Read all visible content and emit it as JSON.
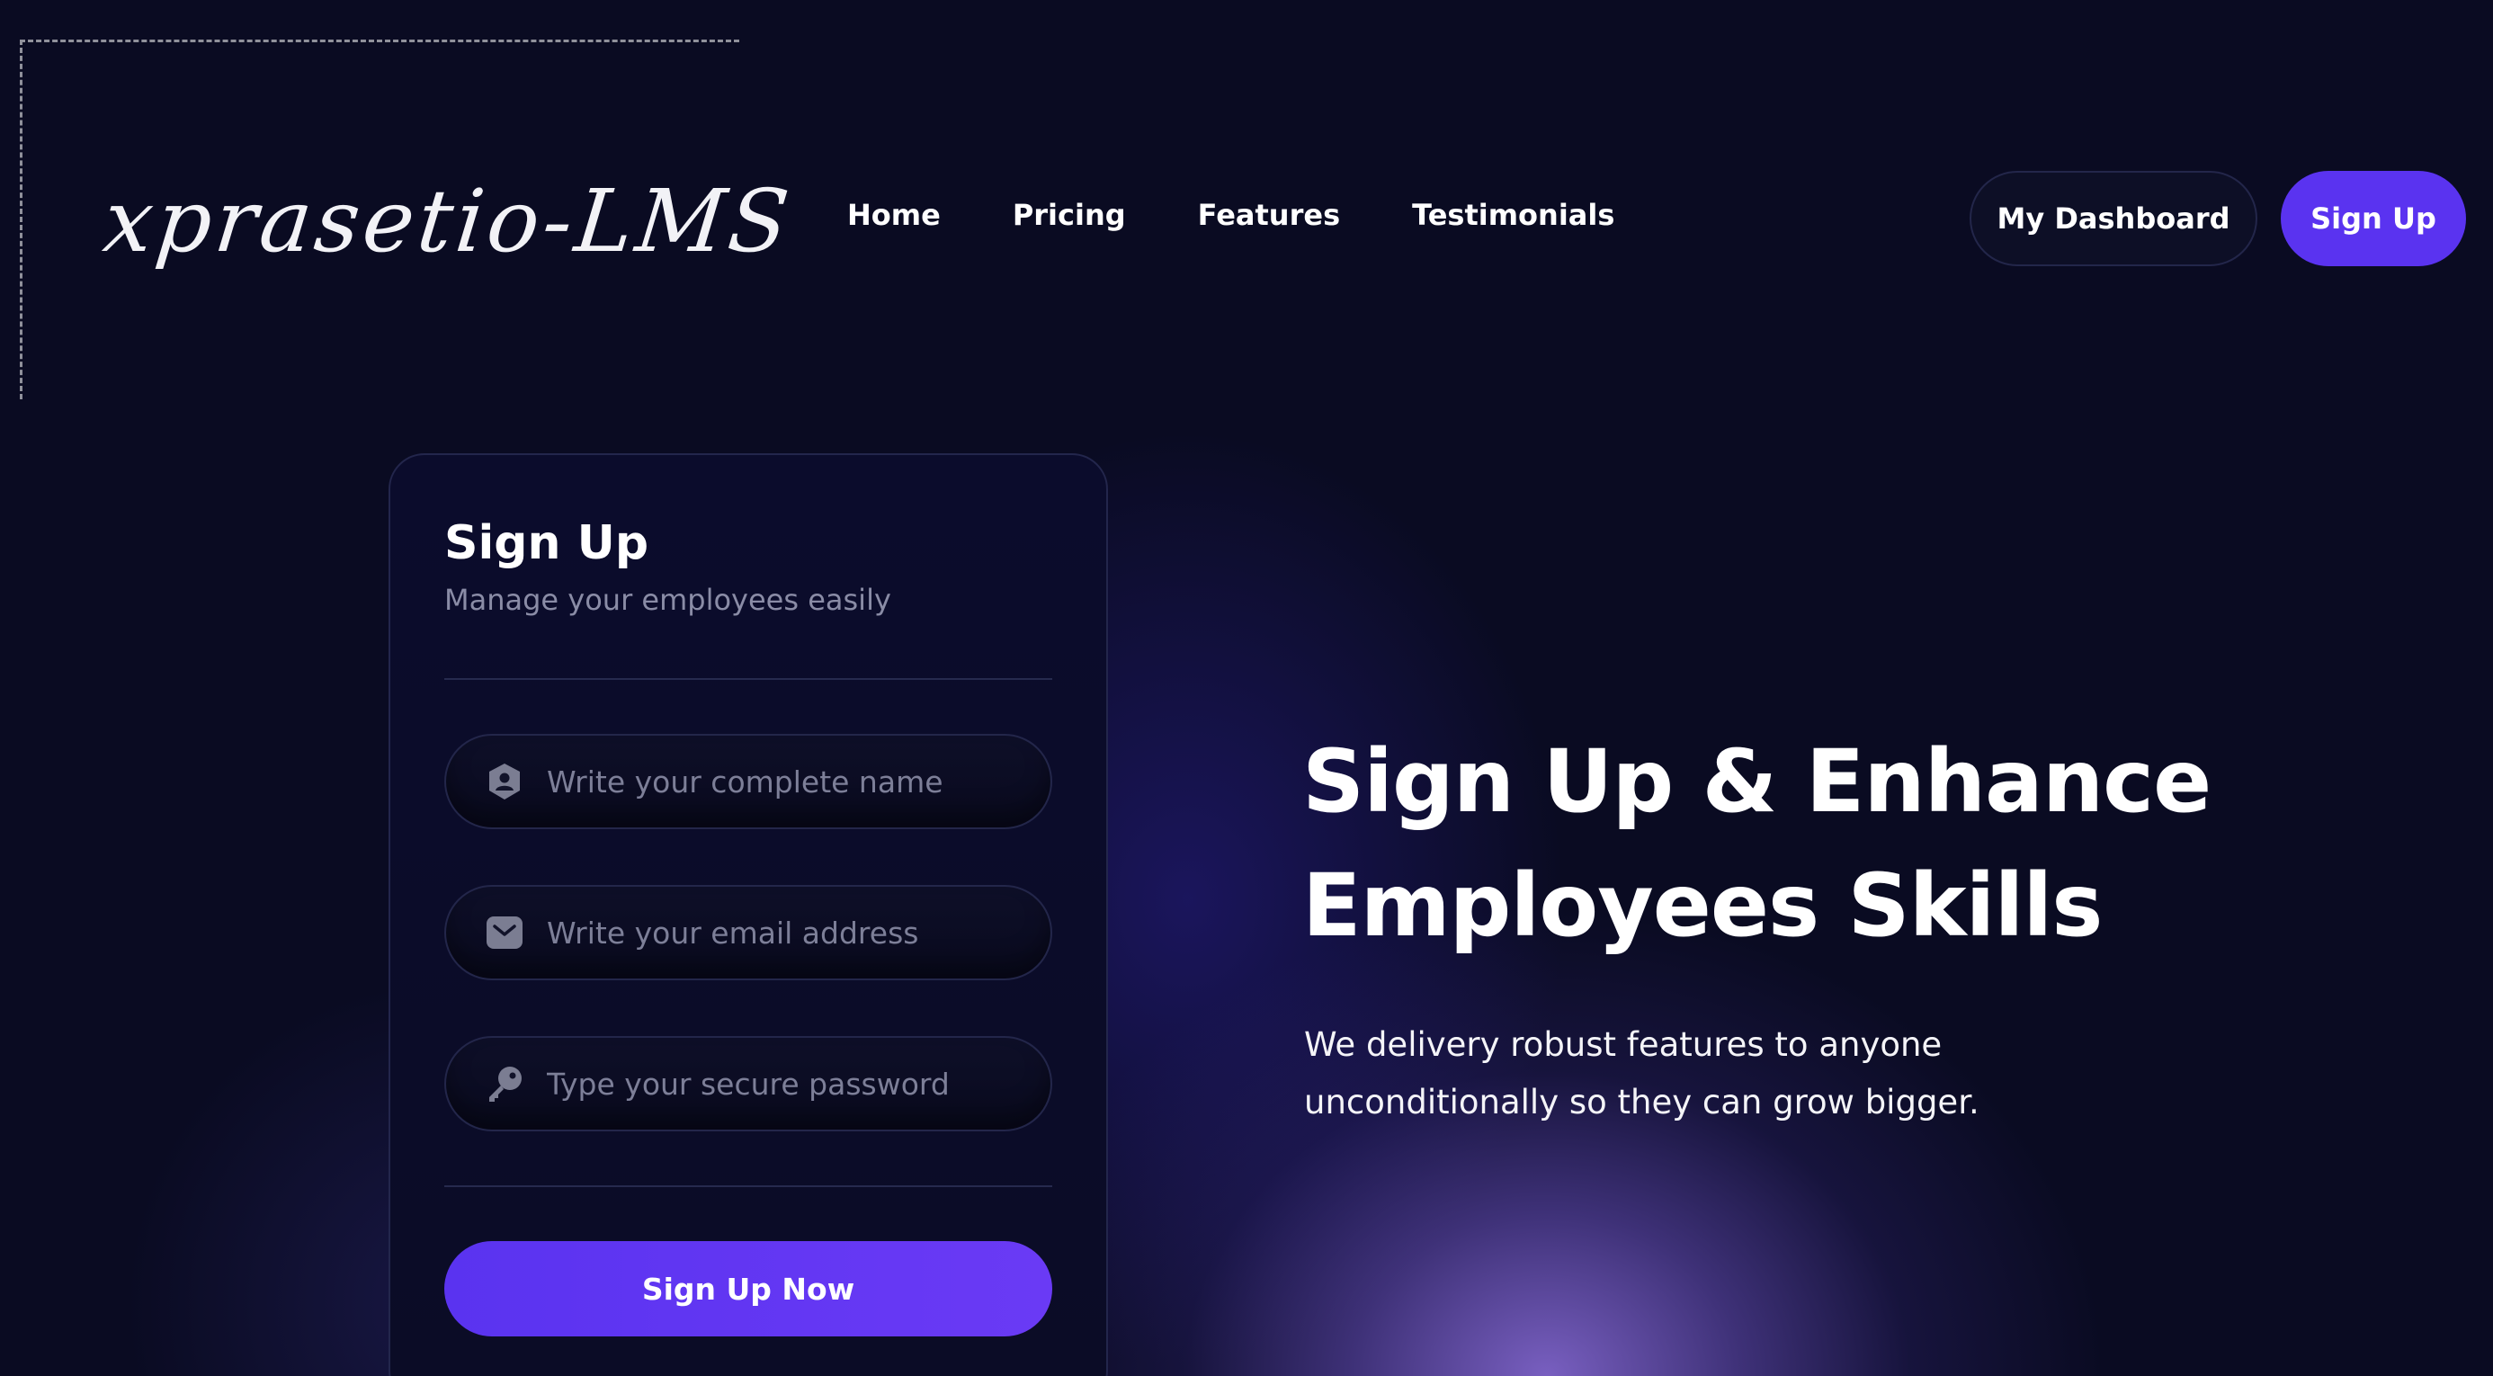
{
  "header": {
    "logo": "xprasetio-LMS",
    "nav": [
      "Home",
      "Pricing",
      "Features",
      "Testimonials"
    ],
    "dashboard_button": "My Dashboard",
    "signup_button": "Sign Up"
  },
  "form": {
    "title": "Sign Up",
    "subtitle": "Manage your employees easily",
    "fields": [
      {
        "icon": "user-shield-icon",
        "placeholder": "Write your complete name",
        "value": ""
      },
      {
        "icon": "envelope-icon",
        "placeholder": "Write your email address",
        "value": ""
      },
      {
        "icon": "key-icon",
        "placeholder": "Type your secure password",
        "value": ""
      }
    ],
    "submit_label": "Sign Up Now"
  },
  "hero": {
    "title_line1": "Sign Up & Enhance",
    "title_line2": "Employees Skills",
    "description": "We delivery robust features to anyone unconditionally so they can grow bigger."
  },
  "colors": {
    "background": "#0a0b22",
    "accent": "#5a33f0",
    "muted_text": "#8a8ca6"
  }
}
